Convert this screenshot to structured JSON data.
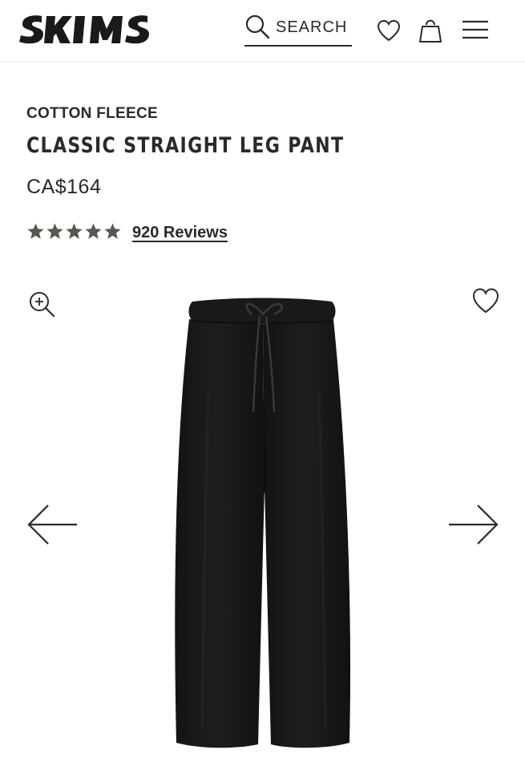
{
  "header": {
    "logo_text": "SKIMS",
    "search_label": "SEARCH",
    "icons": [
      "search-icon",
      "heart-icon",
      "shopping-bag-icon",
      "hamburger-menu-icon"
    ]
  },
  "product": {
    "collection": "COTTON FLEECE",
    "title": "CLASSIC STRAIGHT LEG PANT",
    "price": "CA$164",
    "rating": {
      "stars": 5,
      "max": 5,
      "reviews_label": "920 Reviews"
    },
    "image": {
      "subject": "black straight leg sweatpant",
      "color": "#1c1b1a"
    }
  },
  "gallery": {
    "icons": [
      "zoom-in-icon",
      "heart-outline-icon",
      "arrow-left-icon",
      "arrow-right-icon"
    ]
  },
  "colors": {
    "text": "#2b2a28",
    "star": "#5a5650",
    "divider": "#efefef",
    "background": "#ffffff"
  }
}
